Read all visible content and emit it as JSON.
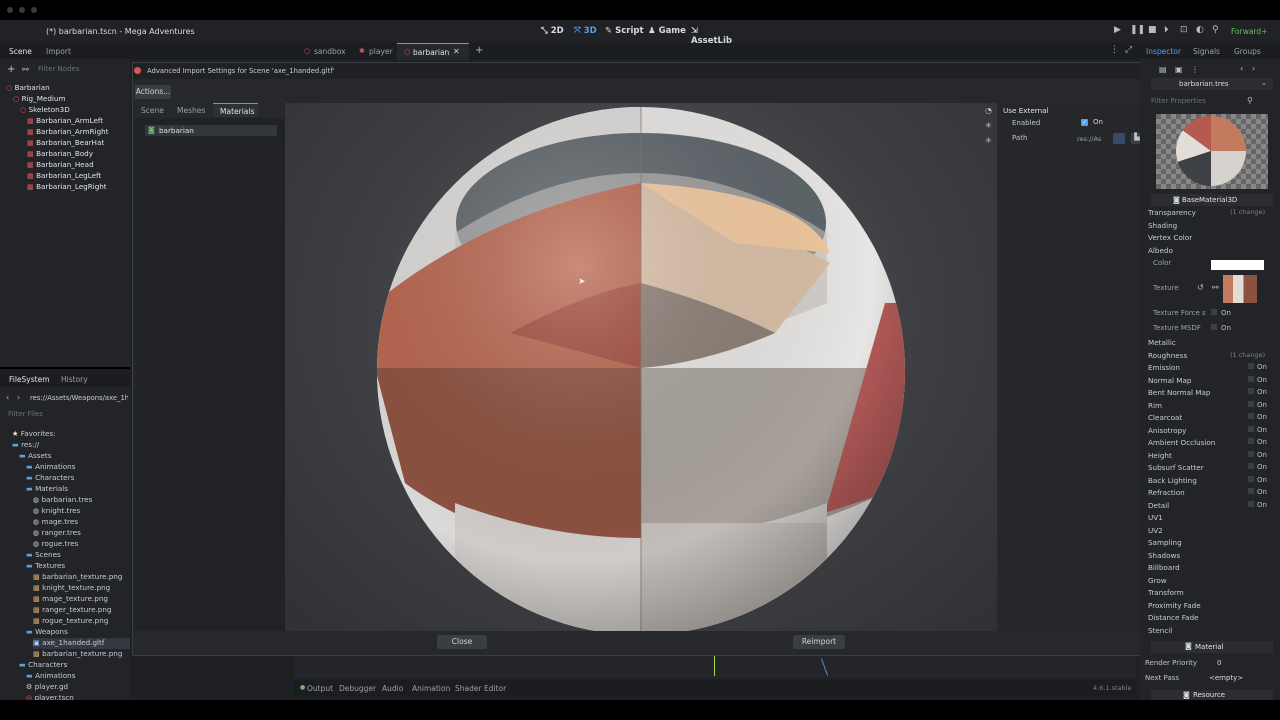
{
  "window": {
    "title": "(*) barbarian.tscn - Mega Adventures"
  },
  "modes": [
    {
      "label": "2D",
      "icon": "2d-icon"
    },
    {
      "label": "3D",
      "icon": "3d-icon"
    },
    {
      "label": "Script",
      "icon": "script-icon"
    },
    {
      "label": "Game",
      "icon": "game-icon"
    },
    {
      "label": "AssetLib",
      "icon": "assetlib-icon"
    }
  ],
  "renderer": "Forward+",
  "left_dock": {
    "tabs": [
      "Scene",
      "Import"
    ],
    "filter_placeholder": "Filter Nodes",
    "tree": [
      {
        "label": "Barbarian",
        "depth": 0
      },
      {
        "label": "Rig_Medium",
        "depth": 1
      },
      {
        "label": "Skeleton3D",
        "depth": 2
      },
      {
        "label": "Barbarian_ArmLeft",
        "depth": 3
      },
      {
        "label": "Barbarian_ArmRight",
        "depth": 3
      },
      {
        "label": "Barbarian_BearHat",
        "depth": 3
      },
      {
        "label": "Barbarian_Body",
        "depth": 3
      },
      {
        "label": "Barbarian_Head",
        "depth": 3
      },
      {
        "label": "Barbarian_LegLeft",
        "depth": 3
      },
      {
        "label": "Barbarian_LegRight",
        "depth": 3
      }
    ]
  },
  "filesystem": {
    "tabs": [
      "FileSystem",
      "History"
    ],
    "path": "res://Assets/Weapons/axe_1h",
    "filter_placeholder": "Filter Files",
    "items": [
      {
        "label": "Favorites:",
        "depth": 0,
        "kind": "star"
      },
      {
        "label": "res://",
        "depth": 0,
        "kind": "folder"
      },
      {
        "label": "Assets",
        "depth": 1,
        "kind": "folder"
      },
      {
        "label": "Animations",
        "depth": 2,
        "kind": "folder"
      },
      {
        "label": "Characters",
        "depth": 2,
        "kind": "folder"
      },
      {
        "label": "Materials",
        "depth": 2,
        "kind": "folder"
      },
      {
        "label": "barbarian.tres",
        "depth": 3,
        "kind": "res"
      },
      {
        "label": "knight.tres",
        "depth": 3,
        "kind": "res"
      },
      {
        "label": "mage.tres",
        "depth": 3,
        "kind": "res"
      },
      {
        "label": "ranger.tres",
        "depth": 3,
        "kind": "res"
      },
      {
        "label": "rogue.tres",
        "depth": 3,
        "kind": "res"
      },
      {
        "label": "Scenes",
        "depth": 2,
        "kind": "folder"
      },
      {
        "label": "Textures",
        "depth": 2,
        "kind": "folder"
      },
      {
        "label": "barbarian_texture.png",
        "depth": 3,
        "kind": "img"
      },
      {
        "label": "knight_texture.png",
        "depth": 3,
        "kind": "img"
      },
      {
        "label": "mage_texture.png",
        "depth": 3,
        "kind": "img"
      },
      {
        "label": "ranger_texture.png",
        "depth": 3,
        "kind": "img"
      },
      {
        "label": "rogue_texture.png",
        "depth": 3,
        "kind": "img"
      },
      {
        "label": "Weapons",
        "depth": 2,
        "kind": "folder"
      },
      {
        "label": "axe_1handed.gltf",
        "depth": 3,
        "kind": "gltf"
      },
      {
        "label": "barbarian_texture.png",
        "depth": 3,
        "kind": "img"
      },
      {
        "label": "Characters",
        "depth": 1,
        "kind": "folder"
      },
      {
        "label": "Animations",
        "depth": 2,
        "kind": "folder"
      },
      {
        "label": "player.gd",
        "depth": 2,
        "kind": "gear"
      },
      {
        "label": "player.tscn",
        "depth": 2,
        "kind": "scene"
      }
    ]
  },
  "scene_tabs": [
    {
      "label": "sandbox",
      "active": false
    },
    {
      "label": "player",
      "active": false
    },
    {
      "label": "barbarian",
      "active": true
    }
  ],
  "dialog": {
    "title": "Advanced Import Settings for Scene 'axe_1handed.gltf'",
    "actions_label": "Actions...",
    "tabs": [
      "Scene",
      "Meshes",
      "Materials"
    ],
    "material_item": "barbarian",
    "use_external": {
      "header": "Use External",
      "enabled_label": "Enabled",
      "enabled_value": "On",
      "path_label": "Path",
      "path_value": "res://As"
    },
    "close_label": "Close",
    "reimport_label": "Reimport"
  },
  "bottom_tabs": [
    "Output",
    "Debugger",
    "Audio",
    "Animation",
    "Shader Editor"
  ],
  "version": "4.6.1.stable",
  "inspector": {
    "tabs": [
      "Inspector",
      "Signals",
      "Groups"
    ],
    "resource": "barbarian.tres",
    "filter_placeholder": "Filter Properties",
    "class_name": "BaseMaterial3D",
    "rows": [
      {
        "label": "Transparency",
        "note": "(1 change)",
        "toggle": false
      },
      {
        "label": "Shading",
        "note": "",
        "toggle": false
      },
      {
        "label": "Vertex Color",
        "note": "",
        "toggle": false
      },
      {
        "label": "Albedo",
        "note": "",
        "toggle": false
      }
    ],
    "albedo_color_label": "Color",
    "albedo_texture_label": "Texture",
    "texture_force_srgb": {
      "label": "Texture Force s",
      "value": "On"
    },
    "texture_msdf": {
      "label": "Texture MSDF",
      "value": "On"
    },
    "sections": [
      {
        "label": "Metallic",
        "note": "",
        "toggle": ""
      },
      {
        "label": "Roughness",
        "note": "(1 change)",
        "toggle": ""
      },
      {
        "label": "Emission",
        "note": "",
        "toggle": "On"
      },
      {
        "label": "Normal Map",
        "note": "",
        "toggle": "On"
      },
      {
        "label": "Bent Normal Map",
        "note": "",
        "toggle": "On"
      },
      {
        "label": "Rim",
        "note": "",
        "toggle": "On"
      },
      {
        "label": "Clearcoat",
        "note": "",
        "toggle": "On"
      },
      {
        "label": "Anisotropy",
        "note": "",
        "toggle": "On"
      },
      {
        "label": "Ambient Occlusion",
        "note": "",
        "toggle": "On"
      },
      {
        "label": "Height",
        "note": "",
        "toggle": "On"
      },
      {
        "label": "Subsurf Scatter",
        "note": "",
        "toggle": "On"
      },
      {
        "label": "Back Lighting",
        "note": "",
        "toggle": "On"
      },
      {
        "label": "Refraction",
        "note": "",
        "toggle": "On"
      },
      {
        "label": "Detail",
        "note": "",
        "toggle": "On"
      },
      {
        "label": "UV1",
        "note": "",
        "toggle": ""
      },
      {
        "label": "UV2",
        "note": "",
        "toggle": ""
      },
      {
        "label": "Sampling",
        "note": "",
        "toggle": ""
      },
      {
        "label": "Shadows",
        "note": "",
        "toggle": ""
      },
      {
        "label": "Billboard",
        "note": "",
        "toggle": ""
      },
      {
        "label": "Grow",
        "note": "",
        "toggle": ""
      },
      {
        "label": "Transform",
        "note": "",
        "toggle": ""
      },
      {
        "label": "Proximity Fade",
        "note": "",
        "toggle": ""
      },
      {
        "label": "Distance Fade",
        "note": "",
        "toggle": ""
      },
      {
        "label": "Stencil",
        "note": "",
        "toggle": ""
      }
    ],
    "material_header": "Material",
    "render_priority_label": "Render Priority",
    "render_priority_value": "0",
    "next_pass_label": "Next Pass",
    "next_pass_value": "<empty>",
    "resource_header": "Resource"
  },
  "colors": {
    "accent": "#5a9fe0",
    "node_red": "#e0555a",
    "panel": "#222428",
    "albedo": "#ffffff"
  }
}
